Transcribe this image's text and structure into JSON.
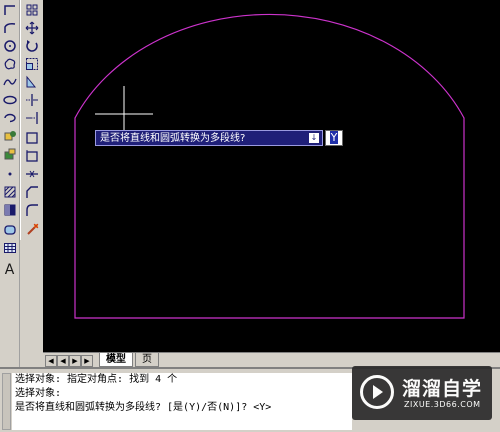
{
  "toolbar_left": {
    "tools": [
      "line-icon",
      "polyline-icon",
      "circle-icon",
      "revcloud-icon",
      "spline-icon",
      "ellipse-icon",
      "ellipse-arc-icon",
      "insert-block-icon",
      "make-block-icon",
      "point-icon",
      "hatch-icon",
      "gradient-icon",
      "region-icon",
      "table-icon"
    ],
    "text_tool_label": "A"
  },
  "toolbar_modify": {
    "tools": [
      "array-icon",
      "move-icon",
      "rotate-icon",
      "scale-icon",
      "stretch-icon",
      "trim-icon",
      "extend-icon",
      "break-icon",
      "break-at-point-icon",
      "join-icon",
      "chamfer-icon",
      "fillet-icon",
      "explode-icon"
    ]
  },
  "prompt": {
    "question": "是否将直线和圆弧转换为多段线?",
    "arrow": "↓",
    "input_value": "Y"
  },
  "tabs": {
    "model": "模型",
    "layout": "页"
  },
  "command_lines": [
    "选择对象: 指定对角点: 找到 4 个",
    "选择对象:",
    "是否将直线和圆弧转换为多段线? [是(Y)/否(N)]? <Y>"
  ],
  "watermark": {
    "name": "溜溜自学",
    "url": "ZIXUE.3D66.COM"
  },
  "colors": {
    "canvas": "#000000",
    "shape_stroke": "#cc33cc",
    "crosshair": "#ffffff",
    "prompt_bg": "#1f1f78"
  }
}
